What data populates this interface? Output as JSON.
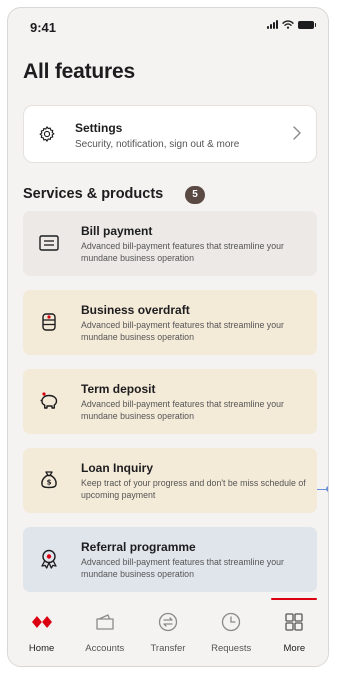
{
  "status_bar": {
    "time": "9:41"
  },
  "page": {
    "title": "All features"
  },
  "settings": {
    "title": "Settings",
    "subtitle": "Security, notification, sign out & more",
    "icon": "gear-icon"
  },
  "services": {
    "section_title": "Services & products",
    "count": "5",
    "items": [
      {
        "name": "Bill payment",
        "description": "Advanced bill-payment features that streamline your mundane business operation",
        "icon": "bill-icon",
        "background": "#ece9e6"
      },
      {
        "name": "Business overdraft",
        "description": "Advanced bill-payment features that streamline your mundane business operation",
        "icon": "coins-icon",
        "background": "#f4ead8"
      },
      {
        "name": "Term deposit",
        "description": "Advanced bill-payment features that streamline your mundane business operation",
        "icon": "piggy-bank-icon",
        "background": "#f4ead8"
      },
      {
        "name": "Loan Inquiry",
        "description": "Keep tract of your progress and don't be miss schedule of upcoming payment",
        "icon": "money-bag-icon",
        "background": "#f4ead8"
      },
      {
        "name": "Referral programme",
        "description": "Advanced bill-payment features that streamline your mundane business operation",
        "icon": "award-icon",
        "background": "#e0e5ec"
      }
    ]
  },
  "bottom_nav": {
    "items": [
      {
        "label": "Home",
        "icon": "hexagon-logo-icon",
        "active": true
      },
      {
        "label": "Accounts",
        "icon": "wallet-icon",
        "active": false
      },
      {
        "label": "Transfer",
        "icon": "transfer-icon",
        "active": false
      },
      {
        "label": "Requests",
        "icon": "clock-icon",
        "active": false
      },
      {
        "label": "More",
        "icon": "grid-icon",
        "active": true
      }
    ]
  },
  "colors": {
    "brand_red": "#db0011",
    "pointer_blue": "#6b8fd6",
    "badge": "#5b4a44"
  }
}
